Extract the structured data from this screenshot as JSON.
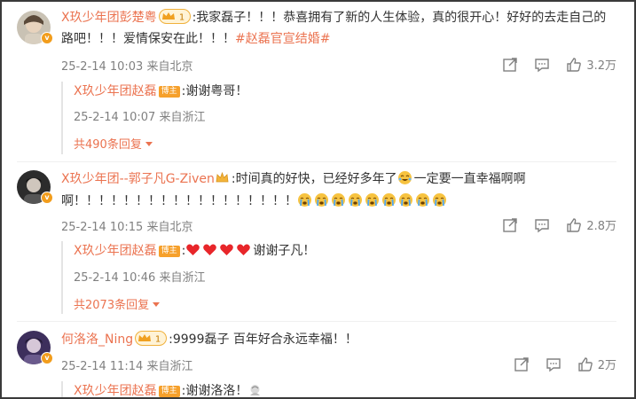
{
  "comments": [
    {
      "user": "X玖少年团彭楚粤",
      "level": "1",
      "text": ":我家磊子！！！恭喜拥有了新的人生体验，真的很开心！好好的去走自己的路吧！！！爱情保安在此！！！",
      "hashtag": "#赵磊官宣结婚#",
      "time": "25-2-14 10:03 来自北京",
      "likes": "3.2万",
      "reply": {
        "user": "X玖少年团赵磊",
        "badge": "博主",
        "text": ":谢谢粤哥！",
        "time": "25-2-14 10:07 来自浙江"
      },
      "more_replies": "共490条回复"
    },
    {
      "user": "X玖少年团--郭子凡G-Ziven",
      "text_part1": ":时间真的好快，已经好多年了",
      "text_part2": "一定要一直幸福啊啊啊！！！！！！！！！！！！！！！！！！",
      "crying_emoji_count": 9,
      "time": "25-2-14 10:15 来自北京",
      "likes": "2.8万",
      "reply": {
        "user": "X玖少年团赵磊",
        "badge": "博主",
        "text": "谢谢子凡！",
        "hearts": 4,
        "time": "25-2-14 10:46 来自浙江"
      },
      "more_replies": "共2073条回复"
    },
    {
      "user": "何洛洛_Ning",
      "level": "1",
      "text": ":9999磊子 百年好合永远幸福！！",
      "time": "25-2-14 11:14 来自浙江",
      "likes": "2万",
      "reply": {
        "user": "X玖少年团赵磊",
        "badge": "博主",
        "text": ":谢谢洛洛！"
      }
    }
  ],
  "colors": {
    "username": "#eb7350",
    "meta": "#808080",
    "badge": "#f6a02b"
  },
  "icons": [
    "share-icon",
    "comment-icon",
    "like-icon",
    "v-badge-icon",
    "heart-emoji",
    "crying-emoji",
    "laugh-cry-emoji"
  ]
}
